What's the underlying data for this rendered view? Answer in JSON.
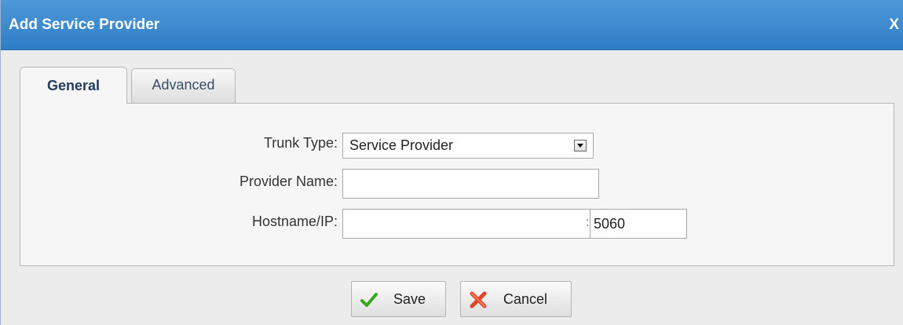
{
  "dialog": {
    "title": "Add Service Provider",
    "close_label": "X"
  },
  "tabs": [
    {
      "label": "General",
      "active": true
    },
    {
      "label": "Advanced",
      "active": false
    }
  ],
  "form": {
    "trunk_type": {
      "label": "Trunk Type:",
      "selected": "Service Provider"
    },
    "provider_name": {
      "label": "Provider Name:",
      "value": ""
    },
    "hostname": {
      "label": "Hostname/IP:",
      "value": "",
      "separator": ":",
      "port": "5060"
    }
  },
  "buttons": {
    "save_label": "Save",
    "cancel_label": "Cancel"
  },
  "icons": {
    "save": "check-icon",
    "cancel": "x-icon",
    "dropdown": "chevron-down-icon"
  },
  "colors": {
    "titlebar": "#3f8bd0",
    "check_green": "#3aa51f",
    "cancel_red": "#e2442a"
  }
}
